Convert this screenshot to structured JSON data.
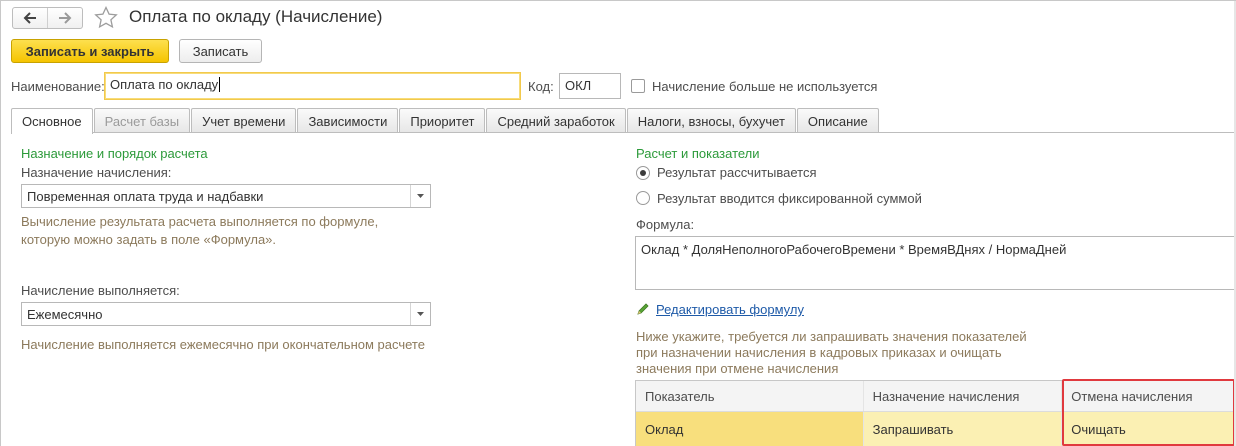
{
  "window": {
    "title": "Оплата по окладу (Начисление)"
  },
  "nav": {
    "back_icon": "arrow-left-icon",
    "forward_icon": "arrow-right-icon",
    "favorite_icon": "star-icon"
  },
  "toolbar": {
    "save_close_label": "Записать и закрыть",
    "save_label": "Записать"
  },
  "header_fields": {
    "name_label": "Наименование:",
    "name_value": "Оплата по окладу",
    "code_label": "Код:",
    "code_value": "ОКЛ",
    "not_used_label": "Начисление больше не используется"
  },
  "tabs": [
    {
      "label": "Основное",
      "state": "active"
    },
    {
      "label": "Расчет базы",
      "state": "disabled"
    },
    {
      "label": "Учет времени",
      "state": "normal"
    },
    {
      "label": "Зависимости",
      "state": "normal"
    },
    {
      "label": "Приоритет",
      "state": "normal"
    },
    {
      "label": "Средний заработок",
      "state": "normal"
    },
    {
      "label": "Налоги, взносы, бухучет",
      "state": "normal"
    },
    {
      "label": "Описание",
      "state": "normal"
    }
  ],
  "left": {
    "section_title": "Назначение и порядок расчета",
    "purpose_label": "Назначение начисления:",
    "purpose_value": "Повременная оплата труда и надбавки",
    "purpose_hint_1": "Вычисление результата расчета выполняется по формуле,",
    "purpose_hint_2": "которую можно задать в поле «Формула».",
    "frequency_label": "Начисление выполняется:",
    "frequency_value": "Ежемесячно",
    "frequency_hint": "Начисление выполняется ежемесячно при окончательном расчете"
  },
  "right": {
    "section_title": "Расчет и показатели",
    "radio_calculated": "Результат рассчитывается",
    "radio_fixed": "Результат вводится фиксированной суммой",
    "formula_label": "Формула:",
    "formula_value": "Оклад * ДоляНеполногоРабочегоВремени * ВремяВДнях / НормаДней",
    "edit_formula_link": "Редактировать формулу",
    "indicators_hint_1": "Ниже укажите, требуется ли запрашивать значения показателей",
    "indicators_hint_2": "при назначении начисления в кадровых приказах и очищать",
    "indicators_hint_3": "значения при отмене начисления"
  },
  "indicators_table": {
    "columns": [
      "Показатель",
      "Назначение начисления",
      "Отмена начисления"
    ],
    "rows": [
      [
        "Оклад",
        "Запрашивать",
        "Очищать"
      ]
    ]
  },
  "colors": {
    "primary_button": "#f5c400",
    "section_title": "#2c9a3a",
    "hint_text": "#8c7a5c",
    "link": "#1e5aa8",
    "selected_row": "#fbf0b3",
    "highlight_box": "#e0393e"
  }
}
